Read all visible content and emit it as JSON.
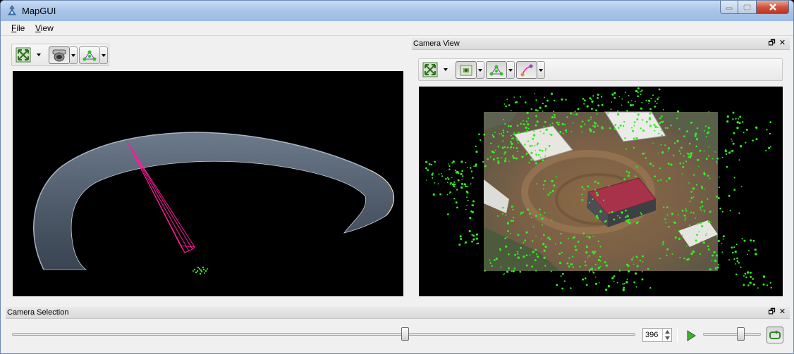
{
  "window": {
    "title": "MapGUI"
  },
  "menubar": {
    "file": {
      "label": "File",
      "mnemonic": "F",
      "rest": "ile"
    },
    "view": {
      "label": "View",
      "mnemonic": "V",
      "rest": "iew"
    }
  },
  "left_toolbar": {
    "buttons": [
      {
        "icon": "zoom-extents-icon",
        "has_dropdown": true
      },
      {
        "icon": "camera-icon",
        "has_dropdown": true,
        "pressed": true
      },
      {
        "icon": "points-icon",
        "has_dropdown": true
      }
    ]
  },
  "camera_view_dock": {
    "title": "Camera View",
    "float_icon": "🗗",
    "close_icon": "✕",
    "toolbar": [
      {
        "icon": "zoom-extents-icon",
        "has_dropdown": true
      },
      {
        "icon": "camera-image-icon",
        "has_dropdown": true,
        "pressed": true
      },
      {
        "icon": "points-icon",
        "has_dropdown": true,
        "pressed": true
      },
      {
        "icon": "residual-icon",
        "has_dropdown": true,
        "pressed": true
      }
    ]
  },
  "camera_selection_dock": {
    "title": "Camera Selection",
    "float_icon": "🗗",
    "close_icon": "✕",
    "frame_value": "396",
    "frame_fraction": 0.63,
    "speed_fraction": 0.65,
    "play_icon": "play-icon",
    "loop_icon": "loop-icon"
  },
  "colors": {
    "point_green": "#33ee22",
    "frustum_magenta": "#ff1a9a",
    "track_surface": "#5a6777",
    "roof_red": "#a8324a"
  }
}
